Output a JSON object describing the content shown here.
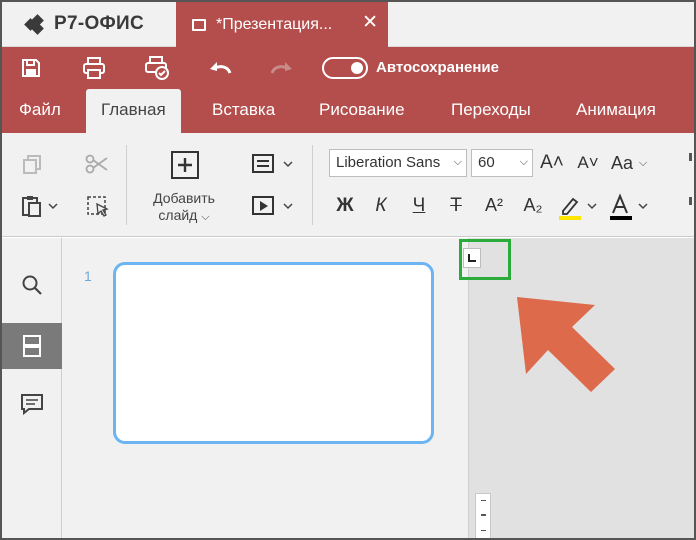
{
  "app": {
    "brand": "Р7-ОФИС"
  },
  "document_tab": {
    "title": "*Презентация...",
    "close_glyph": "✕"
  },
  "quick_access": {
    "autosave_label": "Автосохранение",
    "autosave_on": true
  },
  "menu": {
    "tabs": [
      {
        "label": "Файл",
        "active": false
      },
      {
        "label": "Главная",
        "active": true
      },
      {
        "label": "Вставка",
        "active": false
      },
      {
        "label": "Рисование",
        "active": false
      },
      {
        "label": "Переходы",
        "active": false
      },
      {
        "label": "Анимация",
        "active": false
      }
    ]
  },
  "toolbar": {
    "add_slide_label": "Добавить слайд",
    "add_slide_chevron": "⌵",
    "font_name": "Liberation Sans",
    "font_size": "60",
    "bold": "Ж",
    "italic": "К",
    "underline": "Ч",
    "strike": "Т",
    "superscript": "A²",
    "subscript": "A₂",
    "grow_font": "A˄",
    "shrink_font": "A˅",
    "change_case": "Aa",
    "combo_arrow": "⌵",
    "highlight_color": "#ffe600",
    "font_color": "#000000"
  },
  "thumbnails": {
    "slide_number": "1"
  },
  "colors": {
    "accent": "#b34e4d",
    "thumb_border": "#6cb4f2",
    "highlight_box": "#2bab3a",
    "arrow": "#dc6a4b"
  },
  "icons": [
    "save-icon",
    "print-icon",
    "quick-print-icon",
    "undo-icon",
    "redo-icon",
    "copy-icon",
    "cut-icon",
    "paste-icon",
    "select-all-icon",
    "plus-icon",
    "layout-icon",
    "play-icon",
    "search-icon",
    "slides-icon",
    "comment-icon",
    "tab-stop-icon",
    "pointer-arrow-icon"
  ]
}
